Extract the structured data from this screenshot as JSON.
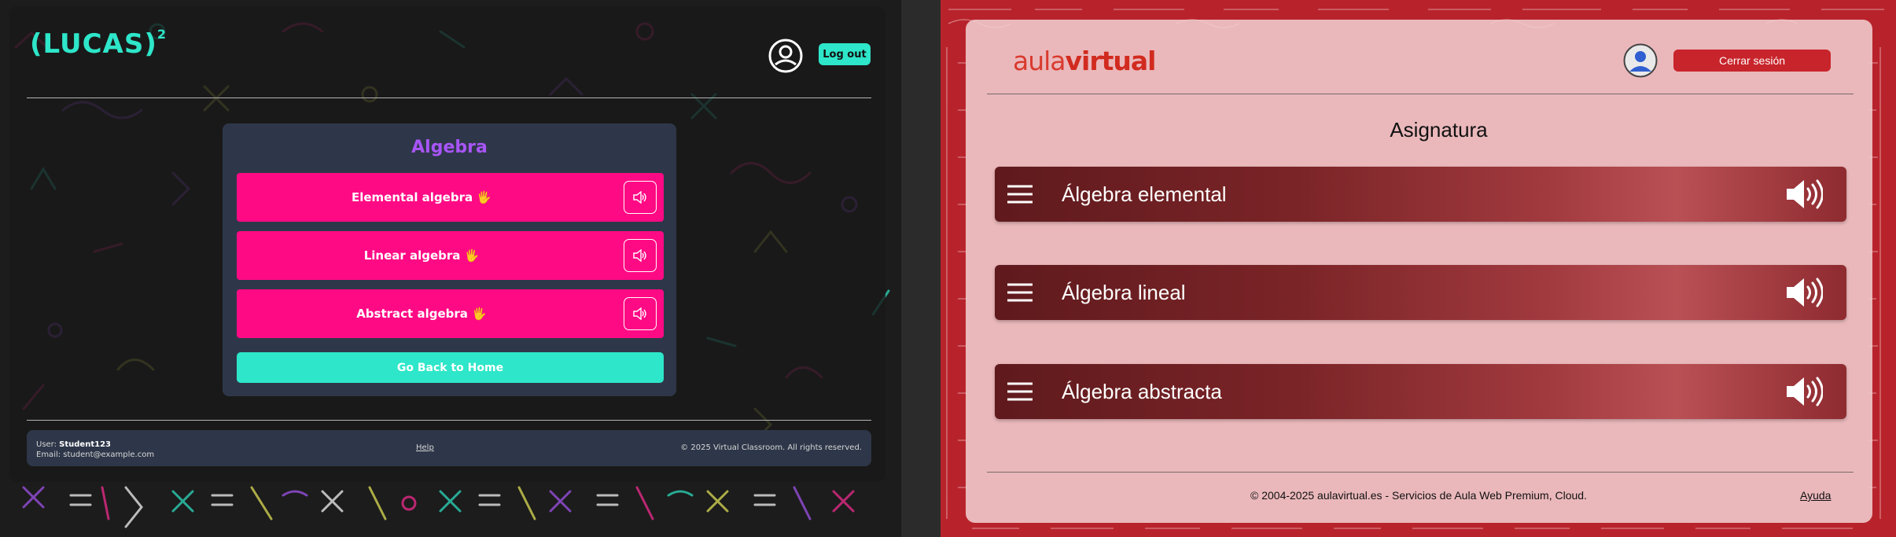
{
  "left": {
    "logo": "(LUCAS)",
    "logo_sup": "2",
    "logout_label": "Log out",
    "card_title": "Algebra",
    "items": [
      {
        "label": "Elemental algebra 🖐"
      },
      {
        "label": "Linear algebra 🖐"
      },
      {
        "label": "Abstract algebra 🖐"
      }
    ],
    "go_home_label": "Go Back to Home",
    "footer": {
      "user_prefix": "User: ",
      "user_name": "Student123",
      "email": "Email: student@example.com",
      "help": "Help",
      "copyright": "© 2025 Virtual Classroom. All rights reserved."
    },
    "colors": {
      "accent": "#2ee6c9",
      "item": "#ff0a85",
      "title": "#a855f7",
      "card": "#2e3749"
    }
  },
  "right": {
    "logo_aula": "aula",
    "logo_virtual": "virtual",
    "logout_label": "Cerrar sesión",
    "page_title": "Asignatura",
    "items": [
      {
        "label": "Álgebra elemental"
      },
      {
        "label": "Álgebra lineal"
      },
      {
        "label": "Álgebra abstracta"
      }
    ],
    "footer": {
      "copyright": "© 2004-2025 aulavirtual.es - Servicios de Aula Web Premium, Cloud.",
      "help": "Ayuda"
    },
    "colors": {
      "brand": "#c8242b",
      "item": "#7a2427"
    }
  },
  "icons": [
    "user-circle-icon",
    "speaker-icon",
    "hamburger-menu-icon",
    "avatar-icon"
  ]
}
